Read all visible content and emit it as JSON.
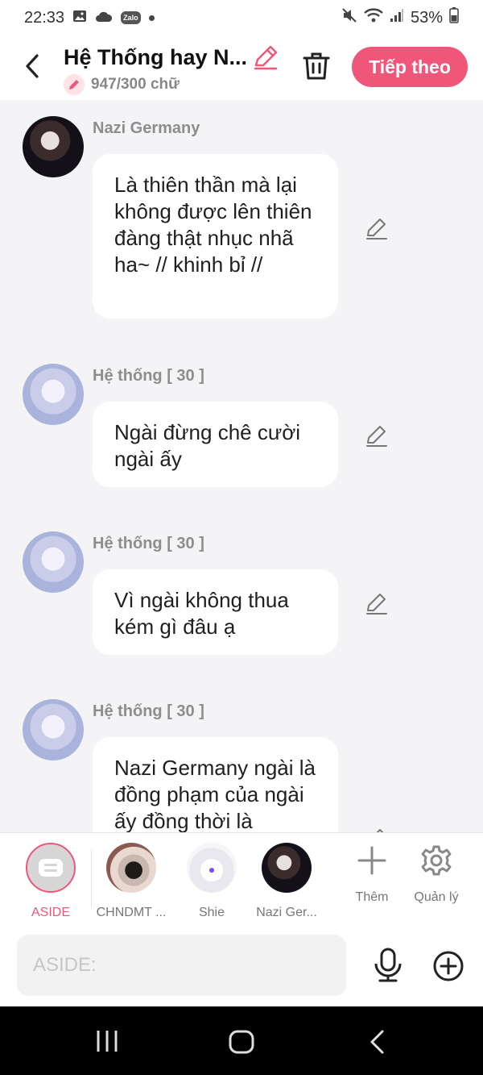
{
  "status_bar": {
    "time": "22:33",
    "zalo_badge": "Zalo",
    "battery": "53%"
  },
  "header": {
    "title": "Hệ Thống hay N...",
    "word_count": "947/300 chữ",
    "next_label": "Tiếp theo"
  },
  "messages": [
    {
      "sender": "Nazi Germany",
      "text": "Là thiên thần mà lại không được lên thiên đàng thật nhục nhã ha~ // khinh bỉ //"
    },
    {
      "sender": "Hệ thống [ 30 ]",
      "text": "Ngài đừng chê cười ngài ấy"
    },
    {
      "sender": "Hệ thống [ 30 ]",
      "text": "Vì ngài không thua kém gì đâu ạ"
    },
    {
      "sender": "Hệ thống [ 30 ]",
      "text": "Nazi Germany ngài là đồng phạm của ngài ấy đồng thời là"
    }
  ],
  "characters": [
    {
      "label": "ASIDE",
      "selected": true
    },
    {
      "label": "CHNDMT ..."
    },
    {
      "label": "Shie"
    },
    {
      "label": "Nazi Ger..."
    }
  ],
  "tools": {
    "add_label": "Thêm",
    "manage_label": "Quản lý"
  },
  "input": {
    "placeholder": "ASIDE:"
  },
  "colors": {
    "accent": "#f0567a",
    "background": "#f4f4f6"
  }
}
